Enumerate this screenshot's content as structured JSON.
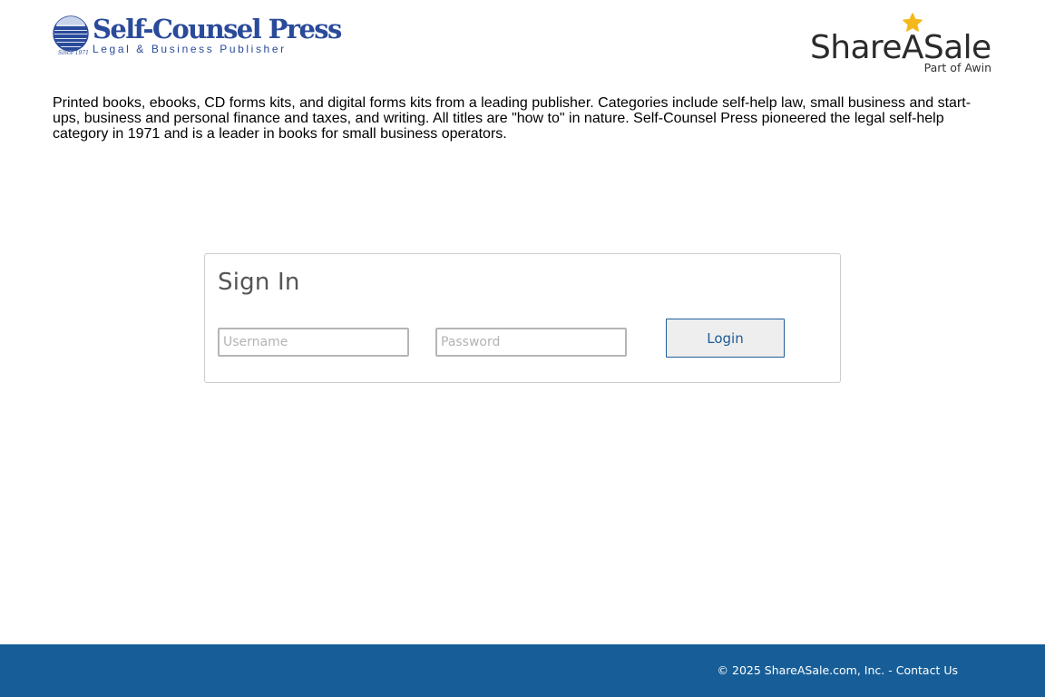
{
  "header": {
    "merchant_logo": {
      "name": "Self-Counsel Press",
      "tagline": "Legal & Business Publisher",
      "since": "Since 1971",
      "icon": "stacked-books-logo-icon",
      "color": "#2a4a9a"
    },
    "network_logo": {
      "name": "ShareASale",
      "sub": "Part of Awin",
      "icon": "star-icon",
      "star_color": "#f5b81c"
    }
  },
  "description": "Printed books, ebooks, CD forms kits, and digital forms kits from a leading publisher. Categories include self-help law, small business and start-ups, business and personal finance and taxes, and writing. All titles are \"how to\" in nature. Self-Counsel Press pioneered the legal self-help category in 1971 and is a leader in books for small business operators.",
  "signin": {
    "title": "Sign In",
    "username": {
      "value": "",
      "placeholder": "Username"
    },
    "password": {
      "value": "",
      "placeholder": "Password"
    },
    "login_label": "Login"
  },
  "footer": {
    "copyright": "© 2025 ShareASale.com, Inc. - ",
    "contact_label": "Contact Us",
    "background": "#175e98"
  }
}
